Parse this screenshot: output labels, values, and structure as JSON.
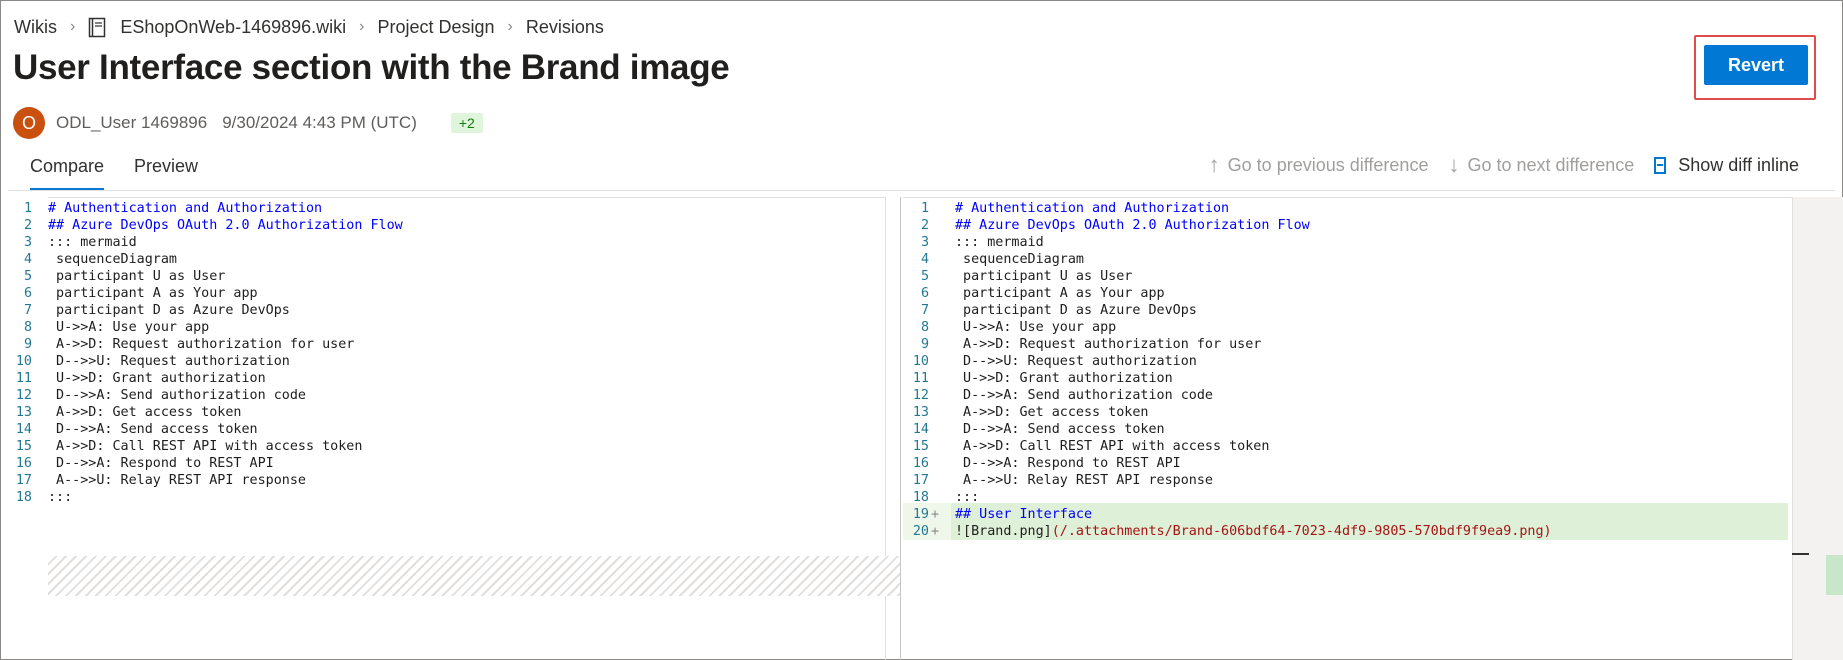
{
  "breadcrumb": {
    "items": [
      "Wikis",
      "EShopOnWeb-1469896.wiki",
      "Project Design",
      "Revisions"
    ]
  },
  "page": {
    "title": "User Interface section with the Brand image"
  },
  "meta": {
    "avatar_initial": "O",
    "user": "ODL_User 1469896",
    "timestamp": "9/30/2024 4:43 PM (UTC)",
    "badge": "+2"
  },
  "actions": {
    "revert_label": "Revert"
  },
  "tabs": [
    {
      "label": "Compare",
      "active": true
    },
    {
      "label": "Preview",
      "active": false
    }
  ],
  "diff_toolbar": {
    "prev_label": "Go to previous difference",
    "next_label": "Go to next difference",
    "inline_label": "Show diff inline"
  },
  "left_lines": [
    {
      "n": "1",
      "text": "# Authentication and Authorization",
      "kind": "heading"
    },
    {
      "n": "2",
      "text": "## Azure DevOps OAuth 2.0 Authorization Flow",
      "kind": "heading"
    },
    {
      "n": "3",
      "text": "::: mermaid",
      "kind": "plain"
    },
    {
      "n": "4",
      "text": " sequenceDiagram",
      "kind": "plain"
    },
    {
      "n": "5",
      "text": " participant U as User",
      "kind": "plain"
    },
    {
      "n": "6",
      "text": " participant A as Your app",
      "kind": "plain"
    },
    {
      "n": "7",
      "text": " participant D as Azure DevOps",
      "kind": "plain"
    },
    {
      "n": "8",
      "text": " U->>A: Use your app",
      "kind": "plain"
    },
    {
      "n": "9",
      "text": " A->>D: Request authorization for user",
      "kind": "plain"
    },
    {
      "n": "10",
      "text": " D-->>U: Request authorization",
      "kind": "plain"
    },
    {
      "n": "11",
      "text": " U->>D: Grant authorization",
      "kind": "plain"
    },
    {
      "n": "12",
      "text": " D-->>A: Send authorization code",
      "kind": "plain"
    },
    {
      "n": "13",
      "text": " A->>D: Get access token",
      "kind": "plain"
    },
    {
      "n": "14",
      "text": " D-->>A: Send access token",
      "kind": "plain"
    },
    {
      "n": "15",
      "text": " A->>D: Call REST API with access token",
      "kind": "plain"
    },
    {
      "n": "16",
      "text": " D-->>A: Respond to REST API",
      "kind": "plain"
    },
    {
      "n": "17",
      "text": " A-->>U: Relay REST API response",
      "kind": "plain"
    },
    {
      "n": "18",
      "text": ":::",
      "kind": "plain"
    }
  ],
  "right_lines": [
    {
      "n": "1",
      "text": "# Authentication and Authorization",
      "kind": "heading"
    },
    {
      "n": "2",
      "text": "## Azure DevOps OAuth 2.0 Authorization Flow",
      "kind": "heading"
    },
    {
      "n": "3",
      "text": "::: mermaid",
      "kind": "plain"
    },
    {
      "n": "4",
      "text": " sequenceDiagram",
      "kind": "plain"
    },
    {
      "n": "5",
      "text": " participant U as User",
      "kind": "plain"
    },
    {
      "n": "6",
      "text": " participant A as Your app",
      "kind": "plain"
    },
    {
      "n": "7",
      "text": " participant D as Azure DevOps",
      "kind": "plain"
    },
    {
      "n": "8",
      "text": " U->>A: Use your app",
      "kind": "plain"
    },
    {
      "n": "9",
      "text": " A->>D: Request authorization for user",
      "kind": "plain"
    },
    {
      "n": "10",
      "text": " D-->>U: Request authorization",
      "kind": "plain"
    },
    {
      "n": "11",
      "text": " U->>D: Grant authorization",
      "kind": "plain"
    },
    {
      "n": "12",
      "text": " D-->>A: Send authorization code",
      "kind": "plain"
    },
    {
      "n": "13",
      "text": " A->>D: Get access token",
      "kind": "plain"
    },
    {
      "n": "14",
      "text": " D-->>A: Send access token",
      "kind": "plain"
    },
    {
      "n": "15",
      "text": " A->>D: Call REST API with access token",
      "kind": "plain"
    },
    {
      "n": "16",
      "text": " D-->>A: Respond to REST API",
      "kind": "plain"
    },
    {
      "n": "17",
      "text": " A-->>U: Relay REST API response",
      "kind": "plain"
    },
    {
      "n": "18",
      "text": ":::",
      "kind": "plain"
    },
    {
      "n": "19",
      "text": "## User Interface",
      "kind": "added-heading"
    },
    {
      "n": "20",
      "text": "![Brand.png]",
      "link": "(/.attachments/Brand-606bdf64-7023-4df9-9805-570bdf9f9ea9.png)",
      "kind": "added-link"
    }
  ]
}
